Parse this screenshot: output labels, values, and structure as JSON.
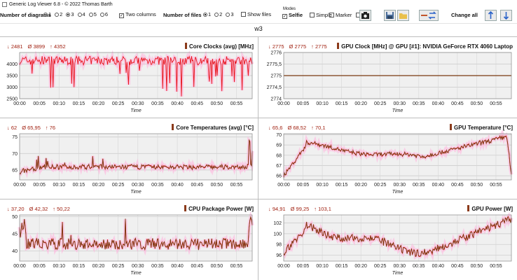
{
  "window": {
    "title": "Generic Log Viewer 6.8 - © 2022 Thomas Barth"
  },
  "toolbar": {
    "diagrams_label": "Number of diagrams",
    "diagram_options": [
      "1",
      "2",
      "3",
      "4",
      "5",
      "6"
    ],
    "diagram_selected": "3",
    "two_columns_label": "Two columns",
    "files_label": "Number of files",
    "file_options": [
      "1",
      "2",
      "3"
    ],
    "file_selected": "1",
    "show_files_label": "Show files",
    "modes_label": "Modes",
    "selfie_label": "Selfie",
    "simple_label": "Simple",
    "marker_label": "Marker",
    "change_all_label": "Change all"
  },
  "workspace_title": "w3",
  "time_label": "Time",
  "x_ticks": [
    "00:00",
    "00:05",
    "00:10",
    "00:15",
    "00:20",
    "00:25",
    "00:30",
    "00:35",
    "00:40",
    "00:45",
    "00:50",
    "00:55"
  ],
  "colors": {
    "series_red": "#e8121a",
    "series_brown": "#7a3b10",
    "band": "#ffb6dd",
    "min": "#a02010"
  },
  "chart_data": [
    {
      "type": "line",
      "title": "Core Clocks (avg) [MHz]",
      "stats": {
        "min": "↓ 2481",
        "avg": "Ø 3899",
        "max": "↑ 4352"
      },
      "ylim": [
        2500,
        4500
      ],
      "yticks": [
        "4000",
        "3500",
        "3000",
        "2500"
      ],
      "ytick_values": [
        4000,
        3500,
        3000,
        2500
      ],
      "xlabel": "Time",
      "profile": "clock"
    },
    {
      "type": "line",
      "title": "GPU Clock [MHz] @ GPU [#1]: NVIDIA GeForce RTX 4060 Laptop",
      "stats": {
        "min": "↓ 2775",
        "avg": "Ø 2775",
        "max": "↑ 2775"
      },
      "ylim": [
        2774,
        2776
      ],
      "yticks": [
        "2776",
        "2775,5",
        "2775",
        "2774,5",
        "2774"
      ],
      "ytick_values": [
        2776,
        2775.5,
        2775,
        2774.5,
        2774
      ],
      "xlabel": "Time",
      "profile": "flat"
    },
    {
      "type": "line",
      "title": "Core Temperatures (avg) [°C]",
      "stats": {
        "min": "↓ 62",
        "avg": "Ø 65,95",
        "max": "↑ 76"
      },
      "ylim": [
        62,
        76
      ],
      "yticks": [
        "75",
        "70",
        "65"
      ],
      "ytick_values": [
        75,
        70,
        65
      ],
      "xlabel": "Time",
      "profile": "coretemp"
    },
    {
      "type": "line",
      "title": "GPU Temperature [°C]",
      "stats": {
        "min": "↓ 65,6",
        "avg": "Ø 68,52",
        "max": "↑ 70,1"
      },
      "ylim": [
        65.6,
        70.1
      ],
      "yticks": [
        "70",
        "69",
        "68",
        "67",
        "66"
      ],
      "ytick_values": [
        70,
        69,
        68,
        67,
        66
      ],
      "xlabel": "Time",
      "profile": "gputemp"
    },
    {
      "type": "line",
      "title": "CPU Package Power [W]",
      "stats": {
        "min": "↓ 37,20",
        "avg": "Ø 42,32",
        "max": "↑ 50,22"
      },
      "ylim": [
        37,
        50.5
      ],
      "yticks": [
        "50",
        "45",
        "40"
      ],
      "ytick_values": [
        50,
        45,
        40
      ],
      "xlabel": "Time",
      "profile": "cpupower"
    },
    {
      "type": "line",
      "title": "GPU Power [W]",
      "stats": {
        "min": "↓ 94,91",
        "avg": "Ø 99,25",
        "max": "↑ 103,1"
      },
      "ylim": [
        94.9,
        103.5
      ],
      "yticks": [
        "102",
        "100",
        "98",
        "96"
      ],
      "ytick_values": [
        102,
        100,
        98,
        96
      ],
      "xlabel": "Time",
      "profile": "gpupower"
    }
  ]
}
